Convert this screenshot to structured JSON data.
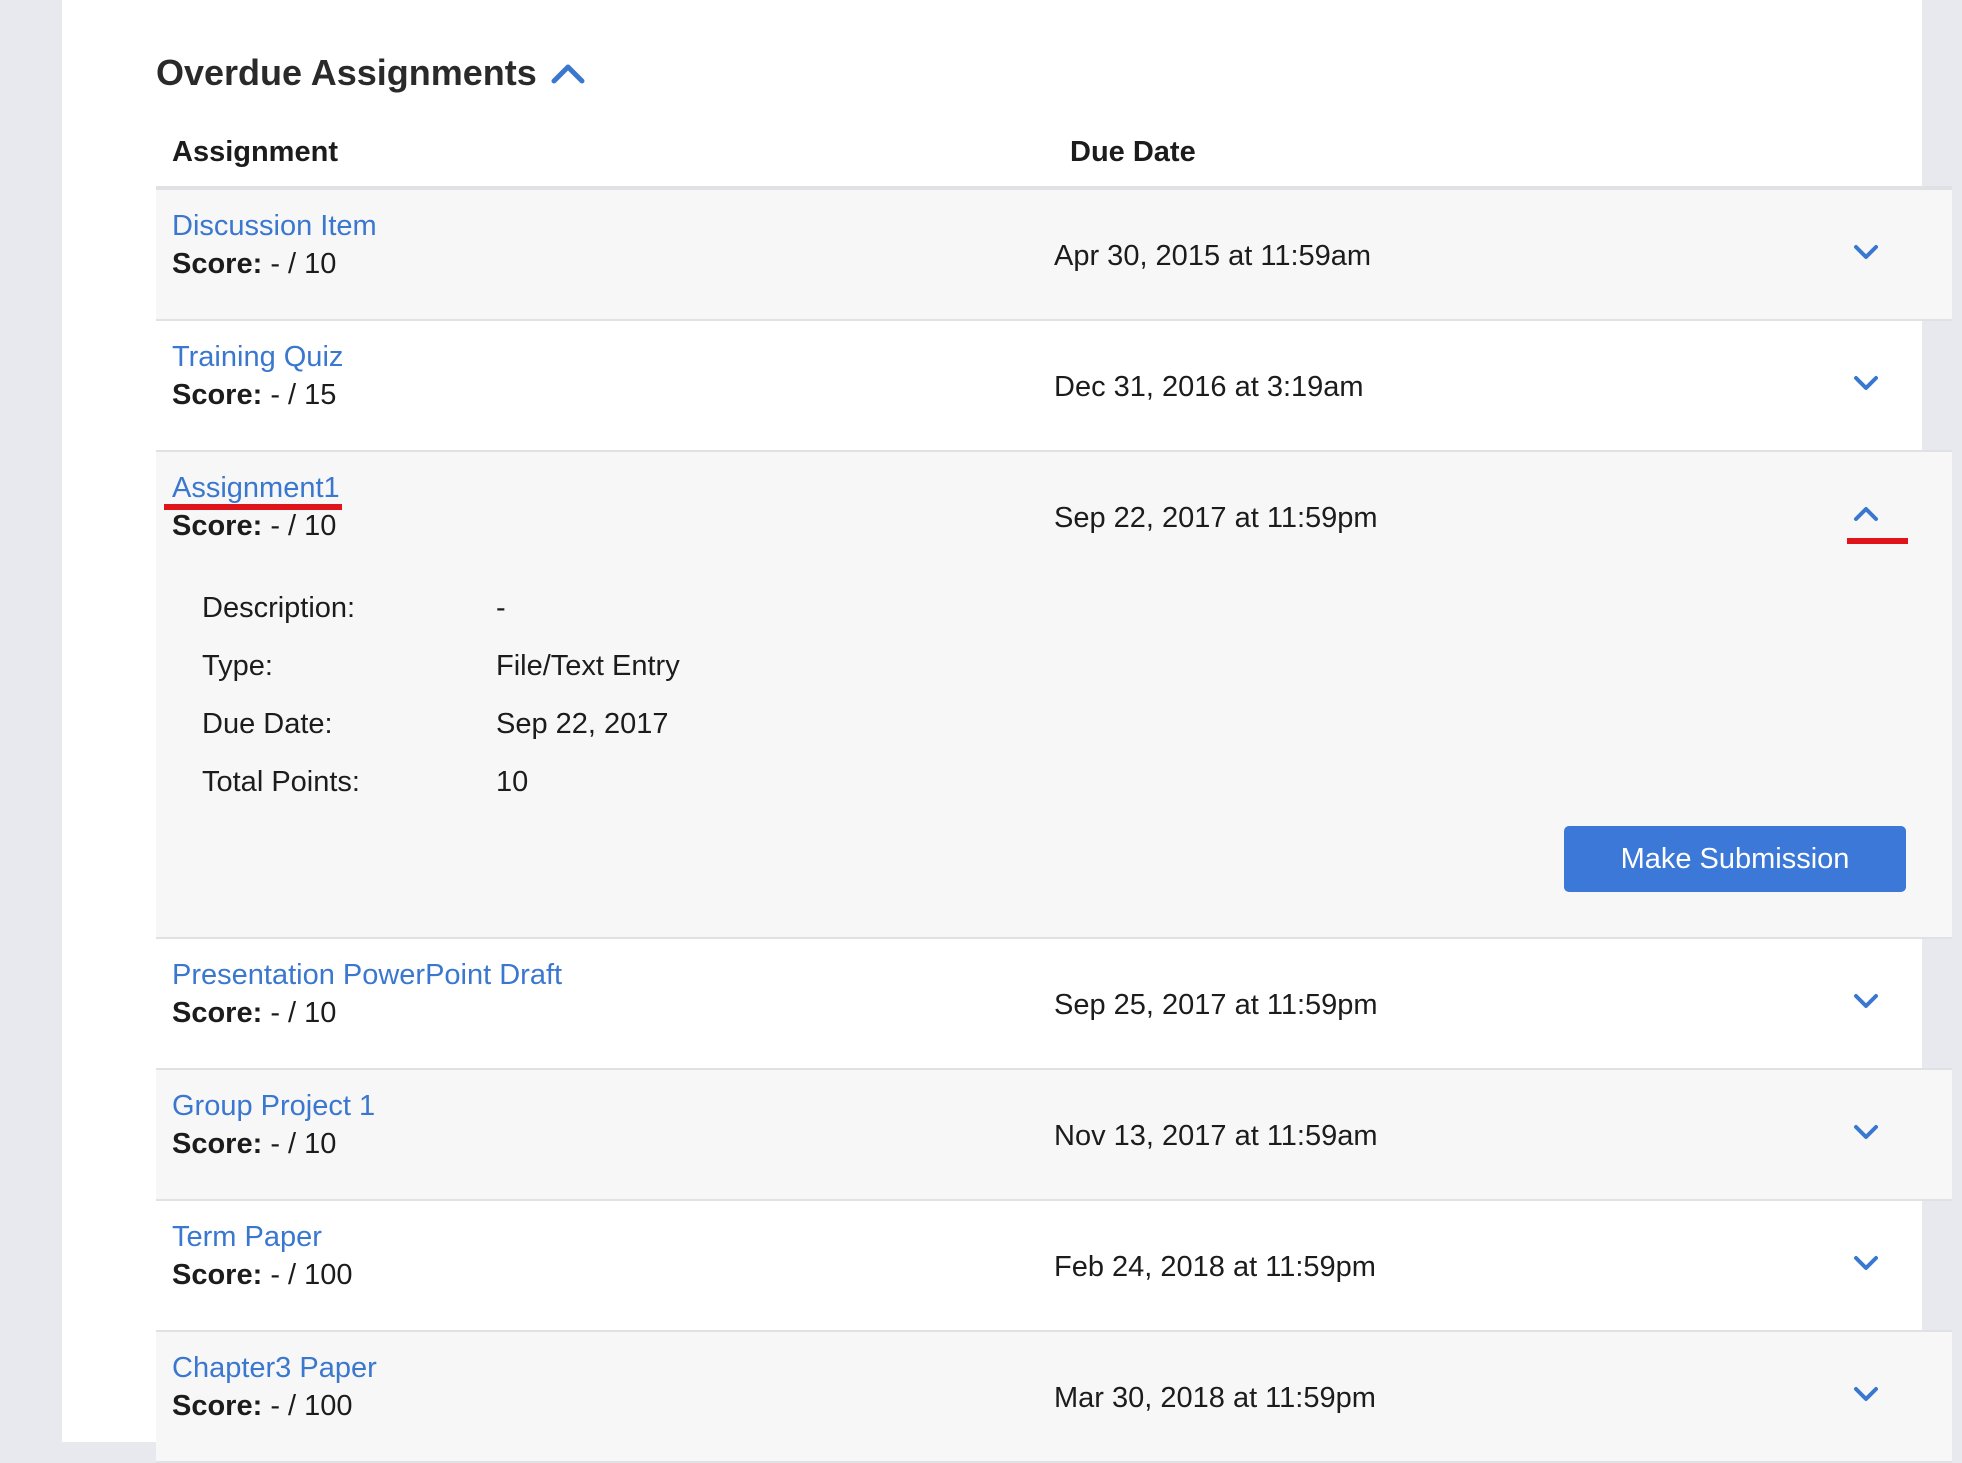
{
  "section": {
    "title": "Overdue Assignments"
  },
  "columns": {
    "assignment": "Assignment",
    "due_date": "Due Date"
  },
  "score_label": "Score:",
  "rows": [
    {
      "title": "Discussion Item",
      "score": "- / 10",
      "due": "Apr 30, 2015 at 11:59am"
    },
    {
      "title": "Training Quiz",
      "score": "- / 15",
      "due": "Dec 31, 2016 at 3:19am"
    },
    {
      "title": "Assignment1",
      "score": "- / 10",
      "due": "Sep 22, 2017 at 11:59pm"
    },
    {
      "title": "Presentation PowerPoint Draft",
      "score": "- / 10",
      "due": "Sep 25, 2017 at 11:59pm"
    },
    {
      "title": "Group Project 1",
      "score": "- / 10",
      "due": "Nov 13, 2017 at 11:59am"
    },
    {
      "title": "Term Paper",
      "score": "- / 100",
      "due": "Feb 24, 2018 at 11:59pm"
    },
    {
      "title": "Chapter3 Paper",
      "score": "- / 100",
      "due": "Mar 30, 2018 at 11:59pm"
    }
  ],
  "details": {
    "description_label": "Description:",
    "description": "-",
    "type_label": "Type:",
    "type": "File/Text Entry",
    "due_label": "Due Date:",
    "due": "Sep 22, 2017",
    "points_label": "Total Points:",
    "points": "10"
  },
  "make_submission": "Make Submission",
  "colors": {
    "link": "#3a77cf",
    "button": "#3b78d8",
    "highlight": "#e0151b"
  }
}
